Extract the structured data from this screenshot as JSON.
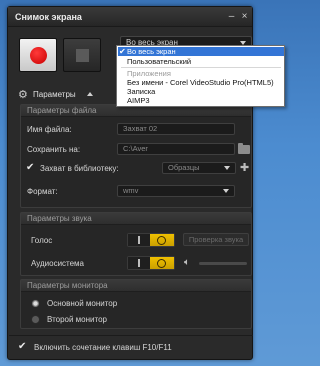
{
  "window": {
    "title": "Снимок экрана",
    "minimize_glyph": "–",
    "close_glyph": "×"
  },
  "capture_mode": {
    "selected": "Во весь экран",
    "options": [
      {
        "label": "Во весь экран",
        "selected": true
      },
      {
        "label": "Пользовательский",
        "selected": false
      },
      {
        "label": "Приложения",
        "group_header": true
      },
      {
        "label": "Без имени - Corel VideoStudio Pro(HTML5)"
      },
      {
        "label": "Записка"
      },
      {
        "label": "AIMP3"
      }
    ]
  },
  "params_toggle": {
    "label": "Параметры"
  },
  "file_params": {
    "header": "Параметры файла",
    "filename_label": "Имя файла:",
    "filename_value": "Захват 02",
    "save_to_label": "Сохранить на:",
    "save_to_value": "C:\\Aver",
    "library_label": "Захват в библиотеку:",
    "library_checked": true,
    "library_value": "Образцы",
    "format_label": "Формат:",
    "format_value": "wmv"
  },
  "audio_params": {
    "header": "Параметры звука",
    "voice_label": "Голос",
    "voice_check_button": "Проверка звука",
    "system_audio_label": "Аудиосистема",
    "system_volume": 0
  },
  "monitor_params": {
    "header": "Параметры монитора",
    "main_monitor_label": "Основной монитор",
    "second_monitor_label": "Второй монитор",
    "selected": "main"
  },
  "hotkeys": {
    "checked": true,
    "label": "Включить сочетание клавиш F10/F11"
  },
  "colors": {
    "window_bg": "#2a2a2a",
    "record_red": "#e00000",
    "toggle_yellow": "#e6b800",
    "selection_blue": "#3375d6",
    "desktop_blue": "#4c8cd0"
  }
}
